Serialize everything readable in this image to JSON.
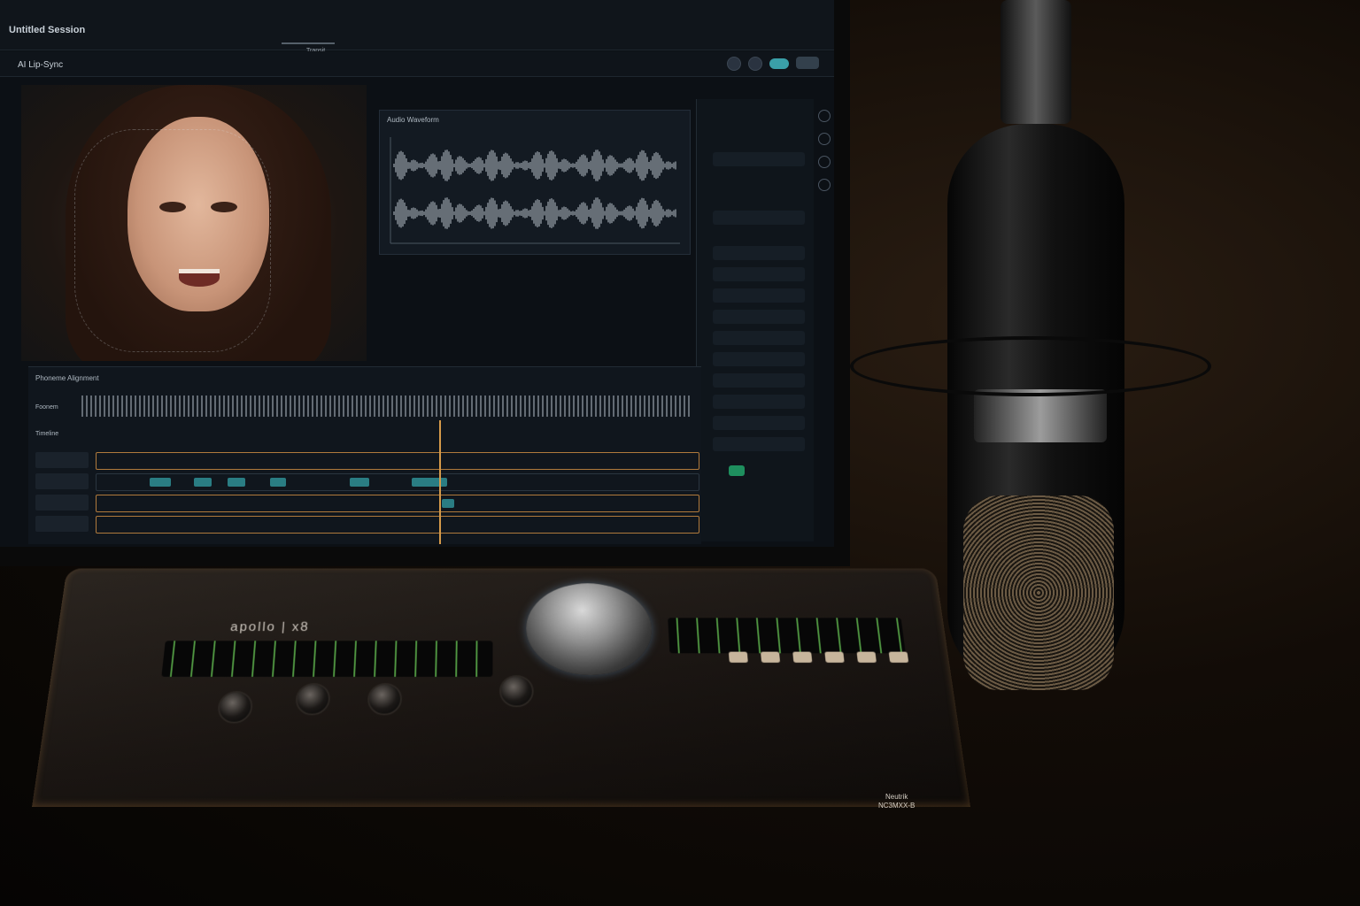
{
  "session_title": "Untitled Session",
  "timeline_label_top": "Transit",
  "app": {
    "title": "AI Lip-Sync"
  },
  "panels": {
    "waveform_title": "Audio Waveform",
    "phoneme_title": "Phoneme Alignment",
    "phoneme_row_label": "Foonem",
    "timeline_row_label": "Timeline"
  },
  "hardware": {
    "interface_brand": "apollo | x8",
    "connector_brand": "Neutrik",
    "connector_model": "NC3MXX-B"
  },
  "colors": {
    "accent_teal": "#2f8f95",
    "playhead": "#d59a4a",
    "meter_green": "#6ed25a"
  }
}
